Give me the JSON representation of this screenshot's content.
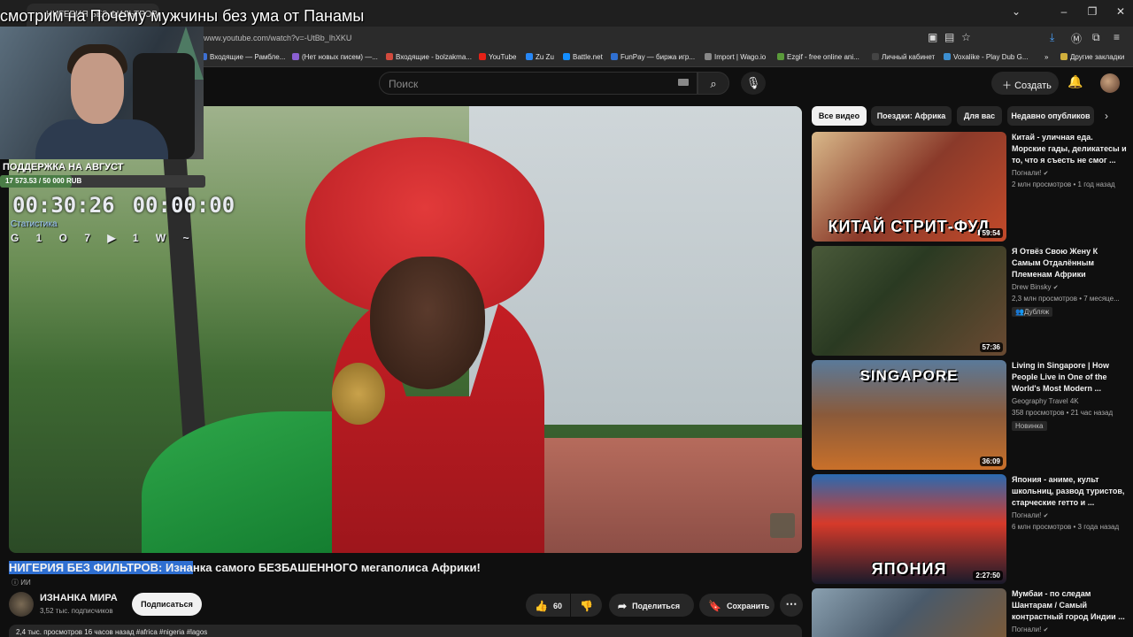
{
  "overlay": {
    "title": "смотрим на Почему мужчины без ума от Панамы",
    "support_title": "ПОДДЕРЖКА НА АВГУСТ",
    "support_amount": "17 573.53 / 50 000 RUB",
    "support_progress": 0.35,
    "timer_left": "00:30:26",
    "timer_right": "00:00:00",
    "stats_label": "Статистика",
    "stats_row": "G 1 O 7 ▶ 1 W ~"
  },
  "browser": {
    "tab_title": "НИГЕРИЯ БЕЗ ФИЛЬТРОВ",
    "url": "www.youtube.com/watch?v=-UtBb_lhXKU",
    "bookmarks": [
      {
        "label": "Входящие — Рамбле...",
        "color": "#3d6fd1"
      },
      {
        "label": "(Нет новых писем) —...",
        "color": "#8a5fd1"
      },
      {
        "label": "Входящие - bolzakma...",
        "color": "#d14a3d"
      },
      {
        "label": "YouTube",
        "color": "#e62117"
      },
      {
        "label": "Zu Zu",
        "color": "#2787f5"
      },
      {
        "label": "Battle.net",
        "color": "#148eff"
      },
      {
        "label": "FunPay — биржа игр...",
        "color": "#2f6fd1"
      },
      {
        "label": "Import | Wago.io",
        "color": "#888888"
      },
      {
        "label": "Ezgif - free online ani...",
        "color": "#5a9a3a"
      },
      {
        "label": "Личный кабинет",
        "color": "#444444"
      },
      {
        "label": "Voxalike - Play Dub G...",
        "color": "#3d8fd1"
      },
      {
        "label": "Другие закладки",
        "color": "#d1b03d"
      }
    ]
  },
  "header": {
    "search_placeholder": "Поиск",
    "create_label": "Создать"
  },
  "video": {
    "title_highlight": "НИГЕРИЯ БЕЗ ФИЛЬТРОВ: Изна",
    "title_rest": "нка самого БЕЗБАШЕННОГО мегаполиса Африки!",
    "ai_badge": "ИИ",
    "channel_name": "ИЗНАНКА МИРА",
    "channel_subs": "3,52 тыс. подписчиков",
    "subscribe_label": "Подписаться",
    "likes": "60",
    "share_label": "Поделиться",
    "save_label": "Сохранить",
    "description_line": "2,4 тыс. просмотров  16 часов назад  #africa #nigeria #lagos"
  },
  "chips": [
    {
      "label": "Все видео",
      "active": true
    },
    {
      "label": "Поездки: Африка",
      "active": false
    },
    {
      "label": "Для вас",
      "active": false
    },
    {
      "label": "Недавно опубликов",
      "active": false
    }
  ],
  "recommendations": [
    {
      "title": "Китай - уличная еда. Морские гады, деликатесы и то, что я съесть не смог ...",
      "channel": "Погнали!",
      "views": "2 млн просмотров • 1 год назад",
      "duration": "59:54",
      "caption": "КИТАЙ СТРИТ-ФУД",
      "badge": ""
    },
    {
      "title": "Я Отвёз Свою Жену К Самым Отдалённым Племенам Африки",
      "channel": "Drew Binsky",
      "views": "2,3 млн просмотров • 7 месяце...",
      "duration": "57:36",
      "caption": "",
      "badge": "Дубляж"
    },
    {
      "title": "Living in Singapore | How People Live in One of the World's Most Modern ...",
      "channel": "Geography Travel 4K",
      "views": "358 просмотров • 21 час назад",
      "duration": "36:09",
      "caption": "SINGAPORE",
      "badge": "Новинка"
    },
    {
      "title": "Япония - аниме, культ школьниц, развод туристов, старческие гетто и ...",
      "channel": "Погнали!",
      "views": "6 млн просмотров • 3 года назад",
      "duration": "2:27:50",
      "caption": "ЯПОНИЯ",
      "badge": ""
    },
    {
      "title": "Мумбаи - по следам Шантарам / Самый контрастный город Индии ...",
      "channel": "Погнали!",
      "views": "",
      "duration": "",
      "caption": "",
      "badge": ""
    }
  ]
}
